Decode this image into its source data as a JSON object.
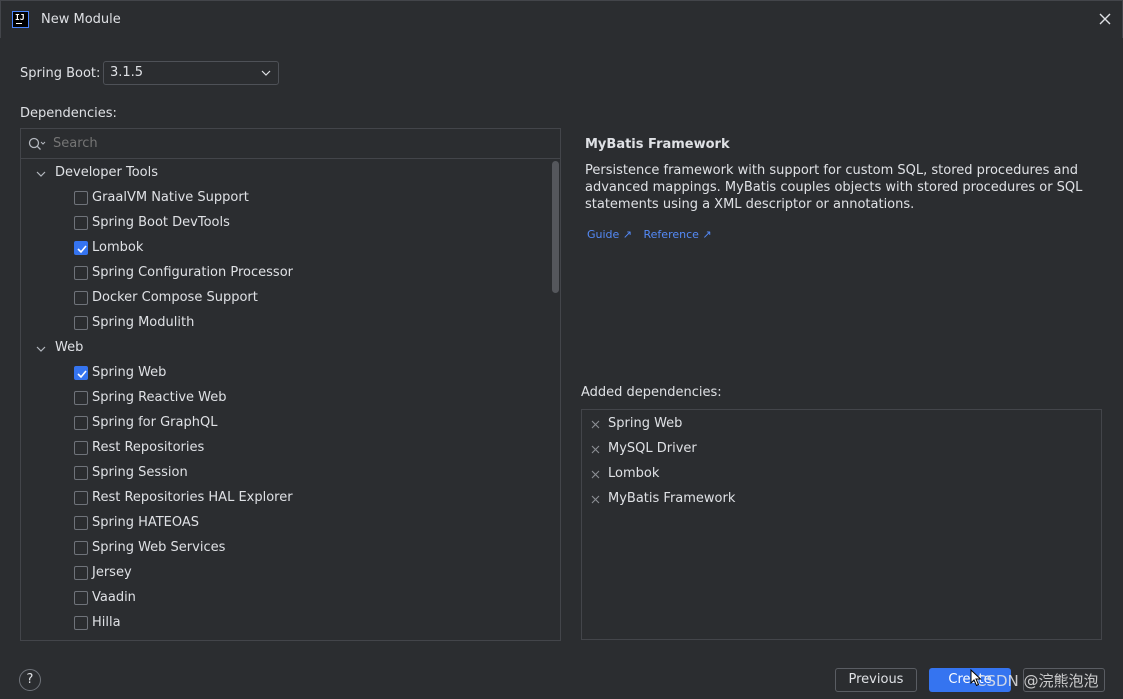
{
  "window": {
    "title": "New Module",
    "logo_text": "IJ"
  },
  "spring_boot": {
    "label": "Spring Boot:",
    "value": "3.1.5"
  },
  "dependencies_label": "Dependencies:",
  "search": {
    "placeholder": "Search"
  },
  "tree": {
    "groups": [
      {
        "name": "Developer Tools",
        "items": [
          {
            "label": "GraalVM Native Support",
            "checked": false
          },
          {
            "label": "Spring Boot DevTools",
            "checked": false
          },
          {
            "label": "Lombok",
            "checked": true
          },
          {
            "label": "Spring Configuration Processor",
            "checked": false
          },
          {
            "label": "Docker Compose Support",
            "checked": false
          },
          {
            "label": "Spring Modulith",
            "checked": false
          }
        ]
      },
      {
        "name": "Web",
        "items": [
          {
            "label": "Spring Web",
            "checked": true
          },
          {
            "label": "Spring Reactive Web",
            "checked": false
          },
          {
            "label": "Spring for GraphQL",
            "checked": false
          },
          {
            "label": "Rest Repositories",
            "checked": false
          },
          {
            "label": "Spring Session",
            "checked": false
          },
          {
            "label": "Rest Repositories HAL Explorer",
            "checked": false
          },
          {
            "label": "Spring HATEOAS",
            "checked": false
          },
          {
            "label": "Spring Web Services",
            "checked": false
          },
          {
            "label": "Jersey",
            "checked": false
          },
          {
            "label": "Vaadin",
            "checked": false
          },
          {
            "label": "Hilla",
            "checked": false
          }
        ]
      }
    ]
  },
  "info": {
    "title": "MyBatis Framework",
    "description": "Persistence framework with support for custom SQL, stored procedures and advanced mappings. MyBatis couples objects with stored procedures or SQL statements using a XML descriptor or annotations.",
    "links": [
      "Guide ↗",
      "Reference ↗"
    ]
  },
  "added": {
    "label": "Added dependencies:",
    "items": [
      "Spring Web",
      "MySQL Driver",
      "Lombok",
      "MyBatis Framework"
    ]
  },
  "footer": {
    "help": "?",
    "previous": "Previous",
    "create": "Create",
    "cancel": ""
  },
  "watermark": "CSDN @浣熊泡泡",
  "colors": {
    "accent": "#3574f0",
    "link": "#548af7",
    "background": "#2b2d30"
  }
}
